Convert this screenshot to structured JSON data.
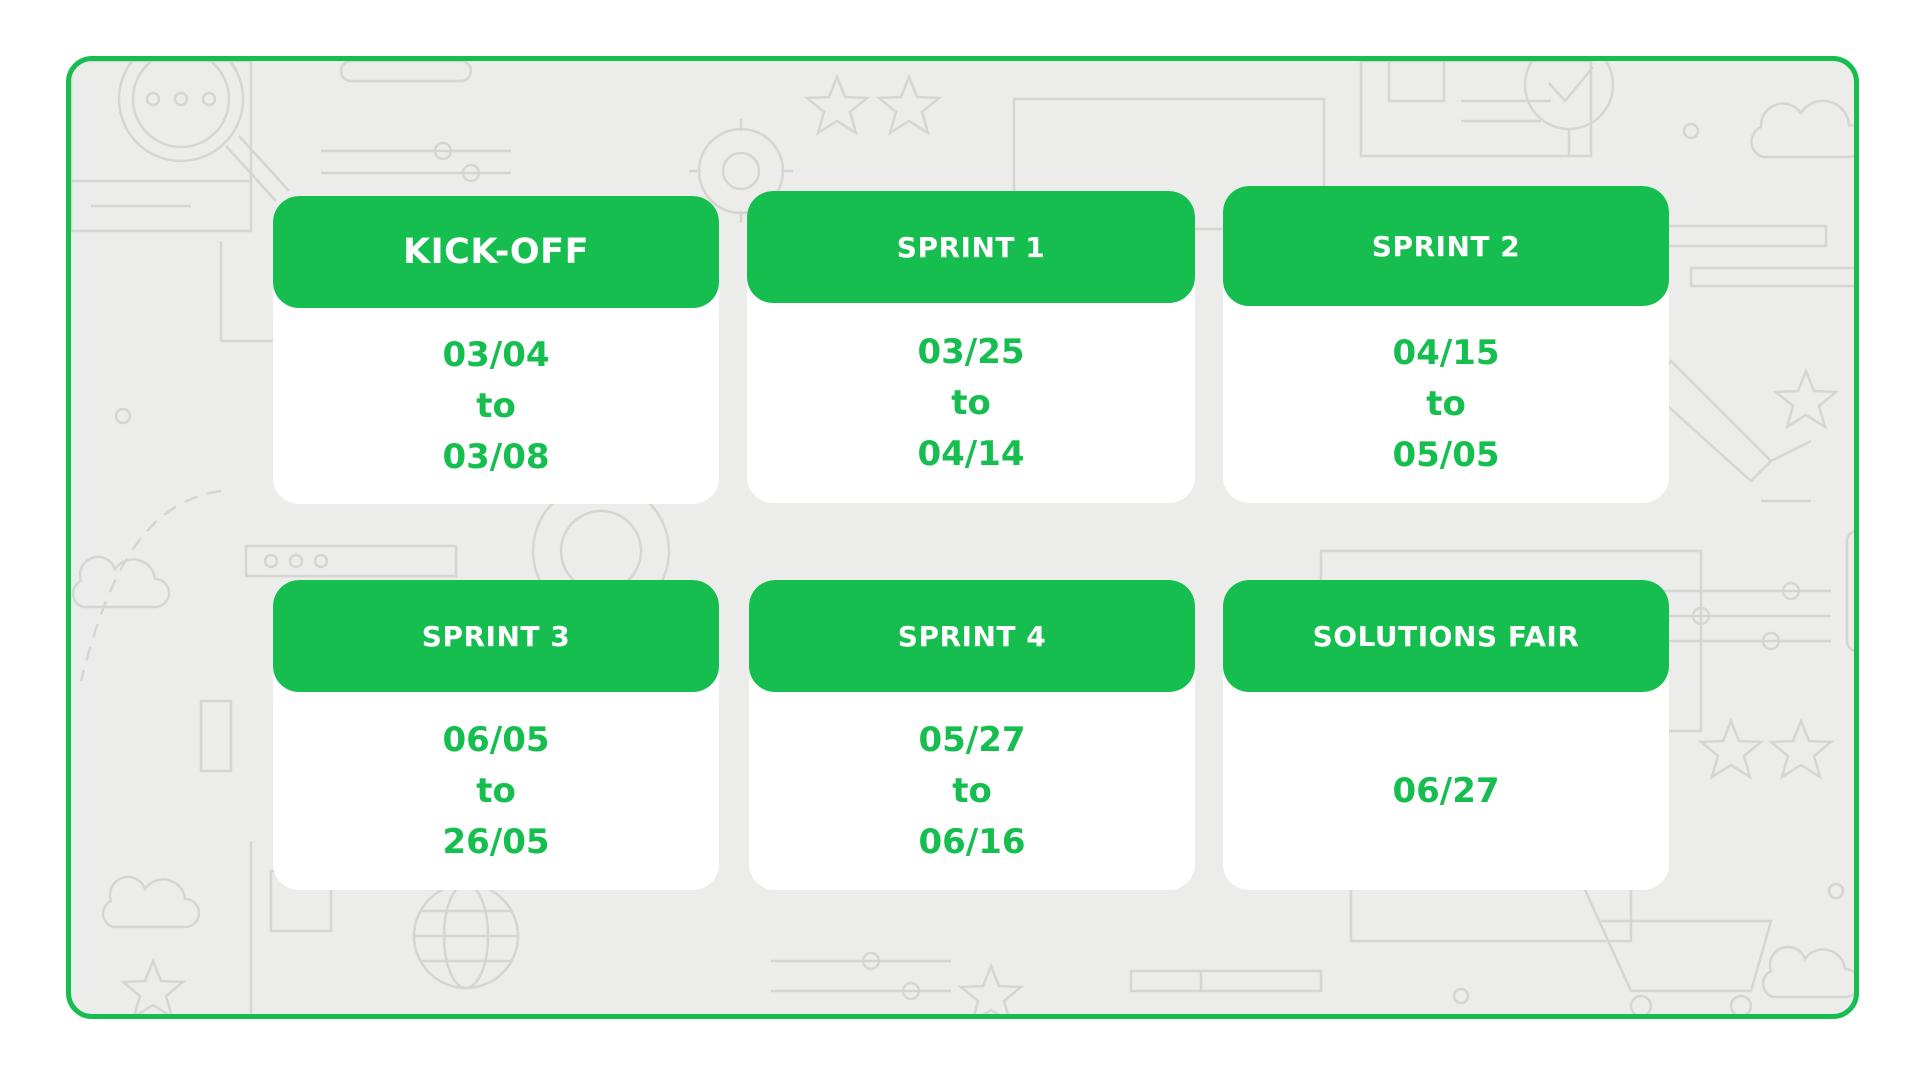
{
  "colors": {
    "accent": "#16be50",
    "frame_background": "#ececeb",
    "card_background": "#ffffff",
    "doodle_stroke": "#d5d5d2"
  },
  "background_icons": [
    "search-icon",
    "star-icon",
    "gear-icon",
    "checkmark-icon",
    "cloud-icon",
    "globe-icon",
    "megaphone-icon",
    "shopping-cart-icon",
    "slider-icon",
    "target-icon"
  ],
  "cards": [
    {
      "title": "KICK-OFF",
      "start": "03/04",
      "connector": "to",
      "end": "03/08"
    },
    {
      "title": "SPRINT 1",
      "start": "03/25",
      "connector": "to",
      "end": "04/14"
    },
    {
      "title": "SPRINT 2",
      "start": "04/15",
      "connector": "to",
      "end": "05/05"
    },
    {
      "title": "SPRINT 3",
      "start": "06/05",
      "connector": "to",
      "end": "26/05"
    },
    {
      "title": "SPRINT 4",
      "start": "05/27",
      "connector": "to",
      "end": "06/16"
    },
    {
      "title": "SOLUTIONS FAIR",
      "date": "06/27"
    }
  ]
}
